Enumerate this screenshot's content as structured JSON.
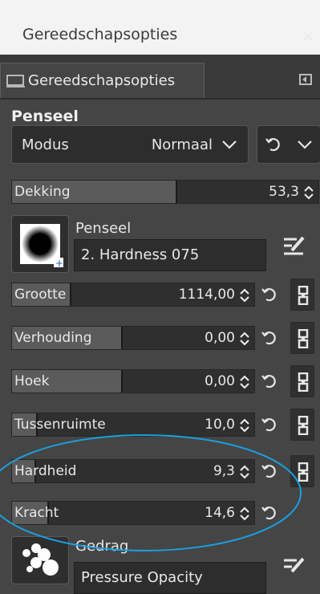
{
  "window": {
    "title": "Gereedschapsopties",
    "close_glyph": "×"
  },
  "tab": {
    "label": "Gereedschapsopties",
    "icon": "tool-options-icon",
    "menu_icon": "tab-menu-icon"
  },
  "section": {
    "title": "Penseel"
  },
  "mode": {
    "label": "Modus",
    "value": "Normaal"
  },
  "opacity": {
    "label": "Dekking",
    "value": "53,3",
    "fill": 0.533
  },
  "brush": {
    "label": "Penseel",
    "name": "2. Hardness 075"
  },
  "sliders": [
    {
      "label": "Grootte",
      "value": "1114,00",
      "fill": 0.24
    },
    {
      "label": "Verhouding",
      "value": "0,00",
      "fill": 0.45
    },
    {
      "label": "Hoek",
      "value": "0,00",
      "fill": 0.45
    },
    {
      "label": "Tussenruimte",
      "value": "10,0",
      "fill": 0.1
    },
    {
      "label": "Hardheid",
      "value": "9,3",
      "fill": 0.093
    },
    {
      "label": "Kracht",
      "value": "14,6",
      "fill": 0.146
    }
  ],
  "dynamics": {
    "label": "Gedrag",
    "name": "Pressure Opacity"
  },
  "annotation": {
    "color": "#1aa0e0"
  }
}
